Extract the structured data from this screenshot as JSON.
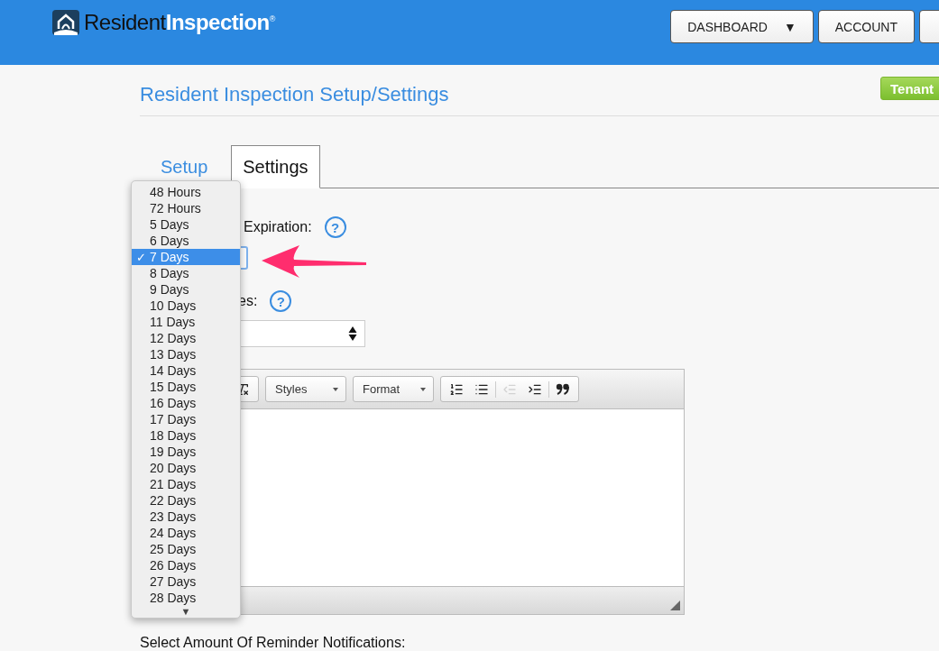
{
  "header": {
    "logo": {
      "first": "Resident",
      "second": "Inspection",
      "mark": "®"
    },
    "nav": [
      {
        "label": "DASHBOARD",
        "caret": "▼"
      },
      {
        "label": "ACCOUNT"
      }
    ]
  },
  "page": {
    "title": "Resident Inspection Setup/Settings",
    "tenant_button": "Tenant"
  },
  "tabs": [
    {
      "label": "Setup",
      "selected": false
    },
    {
      "label": "Settings",
      "selected": true
    }
  ],
  "form": {
    "expiration_label": "Expiration:",
    "expiration_help": "?",
    "second_label": "es:",
    "second_help": "?",
    "editor": {
      "tools": [
        {
          "kind": "clear-format",
          "disabled": false
        },
        {
          "kind": "styles",
          "label": "Styles"
        },
        {
          "kind": "format",
          "label": "Format"
        },
        {
          "kind": "numbered-list",
          "disabled": false
        },
        {
          "kind": "bulleted-list",
          "disabled": false
        },
        {
          "kind": "outdent",
          "disabled": true
        },
        {
          "kind": "indent",
          "disabled": false
        },
        {
          "kind": "blockquote",
          "disabled": false
        }
      ]
    },
    "reminder_label": "Select Amount Of Reminder Notifications:"
  },
  "dropdown": {
    "check": "✓",
    "scroll_arrow": "▼",
    "options": [
      {
        "label": "48 Hours",
        "selected": false
      },
      {
        "label": "72 Hours",
        "selected": false
      },
      {
        "label": "5 Days",
        "selected": false
      },
      {
        "label": "6 Days",
        "selected": false
      },
      {
        "label": "7 Days",
        "selected": true
      },
      {
        "label": "8 Days",
        "selected": false
      },
      {
        "label": "9 Days",
        "selected": false
      },
      {
        "label": "10 Days",
        "selected": false
      },
      {
        "label": "11 Days",
        "selected": false
      },
      {
        "label": "12 Days",
        "selected": false
      },
      {
        "label": "13 Days",
        "selected": false
      },
      {
        "label": "14 Days",
        "selected": false
      },
      {
        "label": "15 Days",
        "selected": false
      },
      {
        "label": "16 Days",
        "selected": false
      },
      {
        "label": "17 Days",
        "selected": false
      },
      {
        "label": "18 Days",
        "selected": false
      },
      {
        "label": "19 Days",
        "selected": false
      },
      {
        "label": "20 Days",
        "selected": false
      },
      {
        "label": "21 Days",
        "selected": false
      },
      {
        "label": "22 Days",
        "selected": false
      },
      {
        "label": "23 Days",
        "selected": false
      },
      {
        "label": "24 Days",
        "selected": false
      },
      {
        "label": "25 Days",
        "selected": false
      },
      {
        "label": "26 Days",
        "selected": false
      },
      {
        "label": "27 Days",
        "selected": false
      },
      {
        "label": "28 Days",
        "selected": false
      }
    ]
  }
}
